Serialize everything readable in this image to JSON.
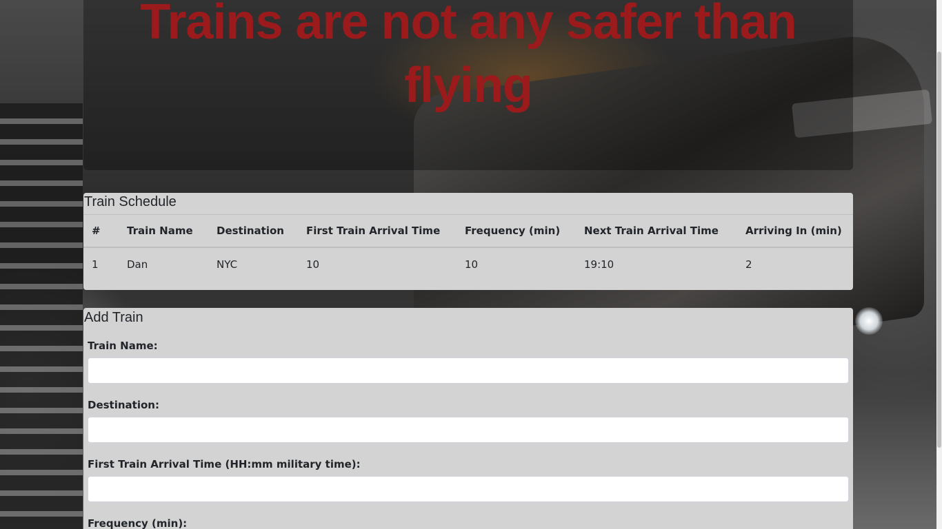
{
  "header": {
    "title": "Trains are not any safer than flying"
  },
  "schedule": {
    "heading": "Train Schedule",
    "columns": [
      "#",
      "Train Name",
      "Destination",
      "First Train Arrival Time",
      "Frequency (min)",
      "Next Train Arrival Time",
      "Arriving In (min)"
    ],
    "rows": [
      [
        "1",
        "Dan",
        "NYC",
        "10",
        "10",
        "19:10",
        "2"
      ]
    ]
  },
  "add_train": {
    "heading": "Add Train",
    "fields": [
      {
        "label": "Train Name:",
        "value": ""
      },
      {
        "label": "Destination:",
        "value": ""
      },
      {
        "label": "First Train Arrival Time (HH:mm military time):",
        "value": ""
      },
      {
        "label": "Frequency (min):",
        "value": ""
      }
    ]
  },
  "colors": {
    "title_red": "#9b1a1c",
    "panel_bg": "#d3d3d3"
  }
}
